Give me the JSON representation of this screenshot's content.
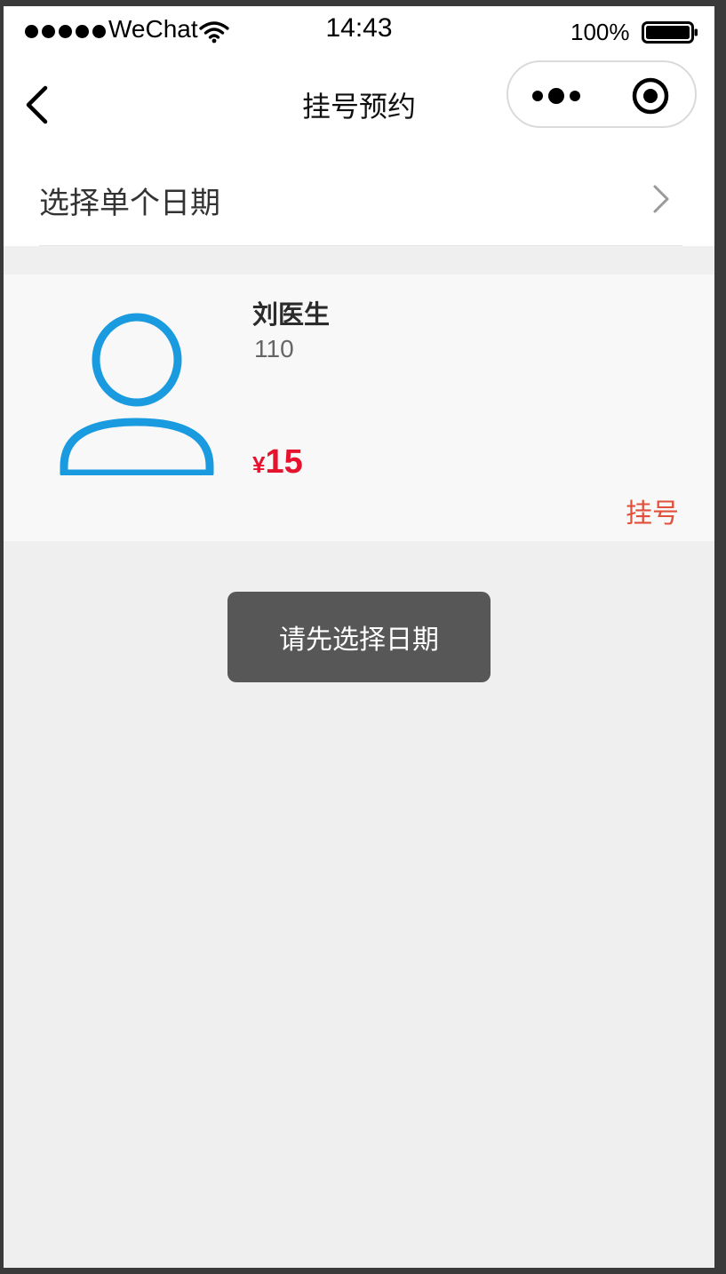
{
  "status_bar": {
    "carrier": "WeChat",
    "time": "14:43",
    "battery": "100%",
    "signal_icon": "signal-dots-icon",
    "wifi_icon": "wifi-icon",
    "battery_icon": "battery-icon"
  },
  "nav": {
    "title": "挂号预约",
    "back_icon": "chevron-left-icon",
    "more_icon": "more-dots-icon",
    "close_icon": "target-circle-icon"
  },
  "date_selector": {
    "label": "选择单个日期",
    "chevron_icon": "chevron-right-icon"
  },
  "doctor": {
    "name": "刘医生",
    "id": "110",
    "currency": "¥",
    "price": "15",
    "action": "挂号",
    "avatar_icon": "user-avatar-icon"
  },
  "toast": {
    "message": "请先选择日期"
  },
  "colors": {
    "avatar": "#1a9be0",
    "price": "#e6132e",
    "action": "#e0503a",
    "toast_bg": "#575757",
    "page_bg": "#efefef"
  }
}
